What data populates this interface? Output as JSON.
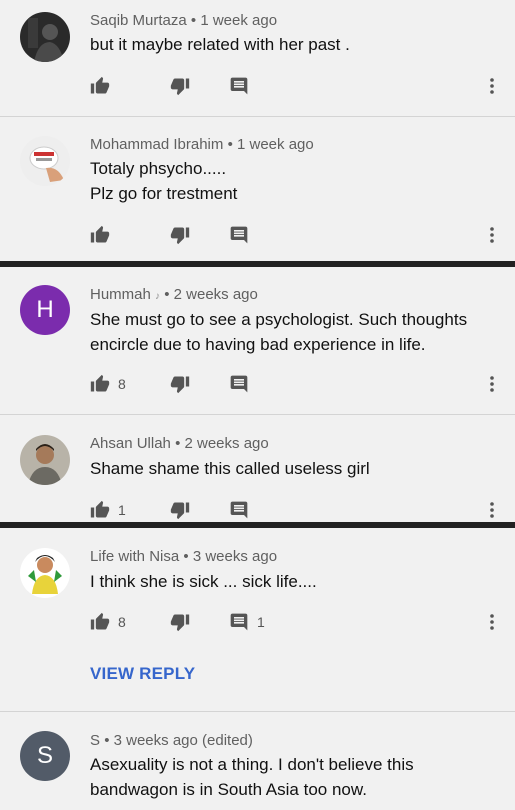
{
  "comments": [
    {
      "author": "Saqib Murtaza",
      "time": "1 week ago",
      "lines": [
        "but it maybe  related with her past ."
      ],
      "likes": "",
      "replies": ""
    },
    {
      "author": "Mohammad Ibrahim",
      "time": "1 week ago",
      "lines": [
        "Totaly phsycho.....",
        "Plz go for trestment"
      ],
      "likes": "",
      "replies": ""
    },
    {
      "author": "Hummah",
      "time": "2 weeks ago",
      "avatar_letter": "H",
      "lines": [
        "She must go to see a psychologist. Such thoughts",
        "encircle due to having bad experience in life."
      ],
      "likes": "8",
      "replies": ""
    },
    {
      "author": "Ahsan Ullah",
      "time": "2 weeks ago",
      "lines": [
        "Shame shame this called useless girl"
      ],
      "likes": "1",
      "replies": ""
    },
    {
      "author": "Life with Nisa",
      "time": "3 weeks ago",
      "lines": [
        "I think she is sick ... sick life...."
      ],
      "likes": "8",
      "replies": "1"
    },
    {
      "author": "S",
      "time": "3 weeks ago (edited)",
      "avatar_letter": "S",
      "lines": [
        "Asexuality is not a thing. I don't believe this",
        "bandwagon is in South Asia too now."
      ],
      "likes": "",
      "replies": ""
    }
  ],
  "meta_separator": "•",
  "view_reply_label": "VIEW REPLY",
  "icons": {
    "like": "thumb-up-icon",
    "dislike": "thumb-down-icon",
    "reply": "comment-icon",
    "more": "more-vert-icon"
  },
  "colors": {
    "accent_link": "#3666cc",
    "avatar_hummah": "#7b2cad",
    "avatar_s": "#525b68"
  }
}
